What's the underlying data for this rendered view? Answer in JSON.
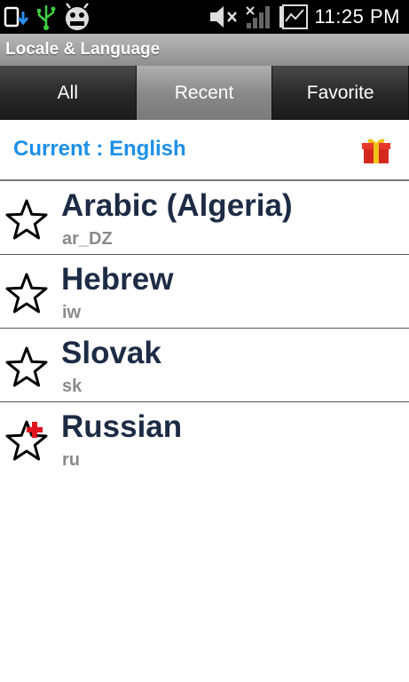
{
  "status_bar": {
    "time": "11:25 PM",
    "icons": [
      "sd-card-icon",
      "usb-icon",
      "debug-bug-icon",
      "mute-icon",
      "signal-icon",
      "battery-icon"
    ]
  },
  "app": {
    "title": "Locale & Language"
  },
  "tabs": [
    {
      "label": "All",
      "selected": false
    },
    {
      "label": "Recent",
      "selected": true
    },
    {
      "label": "Favorite",
      "selected": false
    }
  ],
  "current": {
    "text": "Current : English",
    "icon": "gift-icon"
  },
  "languages": [
    {
      "name": "Arabic (Algeria)",
      "code": "ar_DZ",
      "icon": "star-outline-icon"
    },
    {
      "name": "Hebrew",
      "code": "iw",
      "icon": "star-outline-icon"
    },
    {
      "name": "Slovak",
      "code": "sk",
      "icon": "star-outline-icon"
    },
    {
      "name": "Russian",
      "code": "ru",
      "icon": "star-add-icon"
    }
  ],
  "colors": {
    "accent": "#1e90e8",
    "lang_name": "#1d2b44",
    "lang_code": "#8a8a8a"
  }
}
